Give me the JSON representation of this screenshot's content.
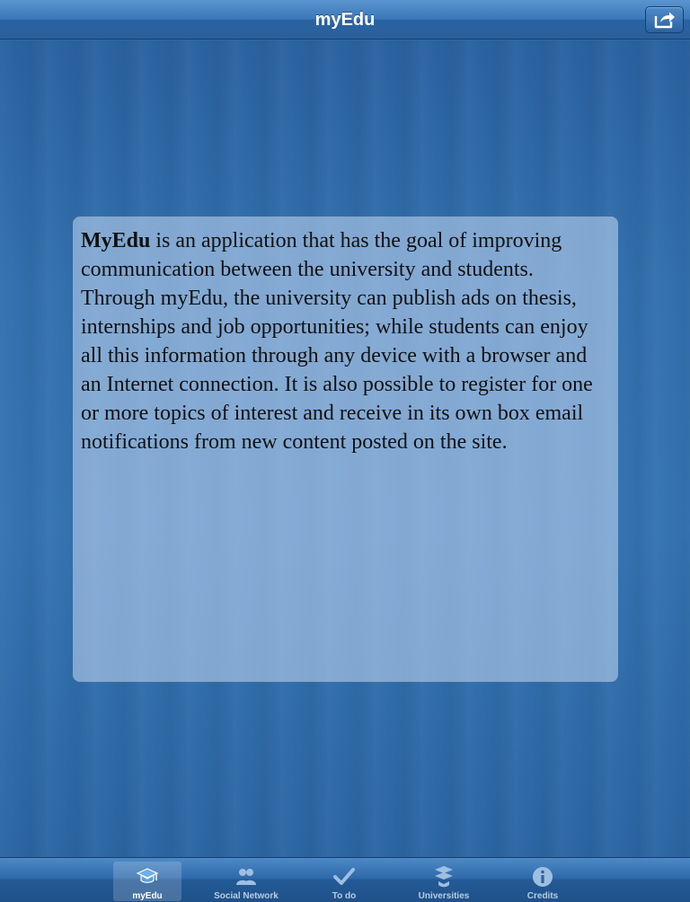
{
  "navbar": {
    "title": "myEdu",
    "share_icon": "share-arrow-icon"
  },
  "card": {
    "bold_lead": "MyEdu",
    "body": " is an application that has the goal of improving communication between the university and students. Through myEdu, the university can publish ads on thesis, internships and job opportunities; while students can enjoy all this information through any device with a browser and an Internet connection. It is also possible to register for one or more topics of interest and receive in its own box email notifications from new content posted on the site."
  },
  "tabs": [
    {
      "label": "myEdu",
      "icon": "graduation-cap-icon",
      "selected": true
    },
    {
      "label": "Social Network",
      "icon": "people-icon",
      "selected": false
    },
    {
      "label": "To do",
      "icon": "checkmark-icon",
      "selected": false
    },
    {
      "label": "Universities",
      "icon": "graduation-caps-icon",
      "selected": false
    },
    {
      "label": "Credits",
      "icon": "info-icon",
      "selected": false
    }
  ],
  "colors": {
    "navbar": "#3a78b9",
    "background": "#2d6aa4",
    "card": "#a9c3e3",
    "tab_label": "#b7cde6"
  }
}
